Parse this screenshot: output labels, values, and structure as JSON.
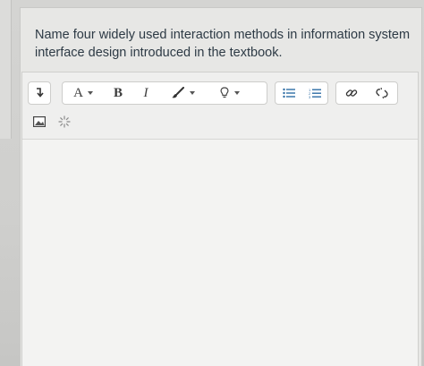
{
  "question": {
    "text": "Name four widely used interaction methods in information system interface design introduced in the textbook."
  },
  "toolbar": {
    "row1": [
      {
        "name": "collapse-toolbar-button",
        "icon": "arrow-down-icon"
      },
      {
        "name": "font-style-button",
        "label": "A",
        "has_caret": true
      },
      {
        "name": "bold-button",
        "label": "B"
      },
      {
        "name": "italic-button",
        "label": "I"
      },
      {
        "name": "text-color-button",
        "icon": "brush-icon",
        "has_caret": true
      },
      {
        "name": "highlight-button",
        "icon": "lightbulb-icon",
        "has_caret": true
      },
      {
        "name": "bullet-list-button",
        "icon": "bullet-list-icon"
      },
      {
        "name": "numbered-list-button",
        "icon": "numbered-list-icon"
      },
      {
        "name": "insert-link-button",
        "icon": "link-icon"
      },
      {
        "name": "unlink-button",
        "icon": "unlink-icon"
      }
    ],
    "row2": [
      {
        "name": "insert-image-button",
        "icon": "image-icon"
      },
      {
        "name": "insert-media-button",
        "icon": "sparkle-icon"
      }
    ],
    "labels": {
      "font_style": "A",
      "bold": "B",
      "italic": "I"
    }
  },
  "editor": {
    "content": ""
  },
  "colors": {
    "page_bg": "#cfcfcd",
    "card_bg": "#e7e7e5",
    "editor_bg": "#f3f3f2",
    "text": "#2d3a45",
    "link_blue": "#2f6ea5"
  }
}
